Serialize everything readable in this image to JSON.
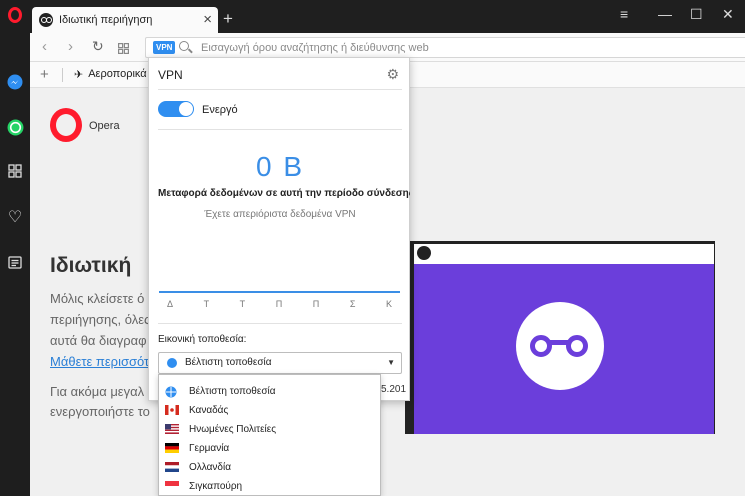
{
  "tab": {
    "title": "Ιδιωτική περιήγηση"
  },
  "address": {
    "vpn_badge": "VPN",
    "placeholder": "Εισαγωγή όρου αναζήτησης ή διεύθυνσης web"
  },
  "bookmarks": {
    "items": [
      {
        "label": "Αεροπορικά εισιτήρια"
      }
    ]
  },
  "page": {
    "brand": "Opera",
    "heading": "Ιδιωτική",
    "lines": [
      "Μόλις κλείσετε ό",
      "περιήγησης, όλες",
      "αυτά θα διαγραφ"
    ],
    "link": "Μάθετε περισσότε",
    "lines2": [
      "Για ακόμα μεγαλ",
      "ενεργοποιήστε το"
    ]
  },
  "vpn": {
    "title": "VPN",
    "status": "Ενεργό",
    "enabled": true,
    "data_amount": "0 B",
    "data_desc": "Μεταφορά δεδομένων σε αυτή την περίοδο σύνδεσης",
    "unlimited": "Έχετε απεριόριστα δεδομένα VPN",
    "days": [
      "Δ",
      "Τ",
      "Τ",
      "Π",
      "Π",
      "Σ",
      "Κ"
    ],
    "location_label": "Εικονική τοποθεσία:",
    "selected_location": "Βέλτιστη τοποθεσία",
    "ip_partial": "5.201"
  },
  "dropdown": {
    "options": [
      {
        "label": "Βέλτιστη τοποθεσία",
        "icon": "globe-icon"
      },
      {
        "label": "Καναδάς",
        "icon": "flag-canada-icon"
      },
      {
        "label": "Ηνωμένες Πολιτείες",
        "icon": "flag-usa-icon"
      },
      {
        "label": "Γερμανία",
        "icon": "flag-germany-icon"
      },
      {
        "label": "Ολλανδία",
        "icon": "flag-netherlands-icon"
      },
      {
        "label": "Σιγκαπούρη",
        "icon": "flag-singapore-icon"
      }
    ]
  },
  "colors": {
    "accent": "#2f8ef0",
    "opera_red": "#ff1b2d",
    "illustration": "#6b3edb"
  }
}
